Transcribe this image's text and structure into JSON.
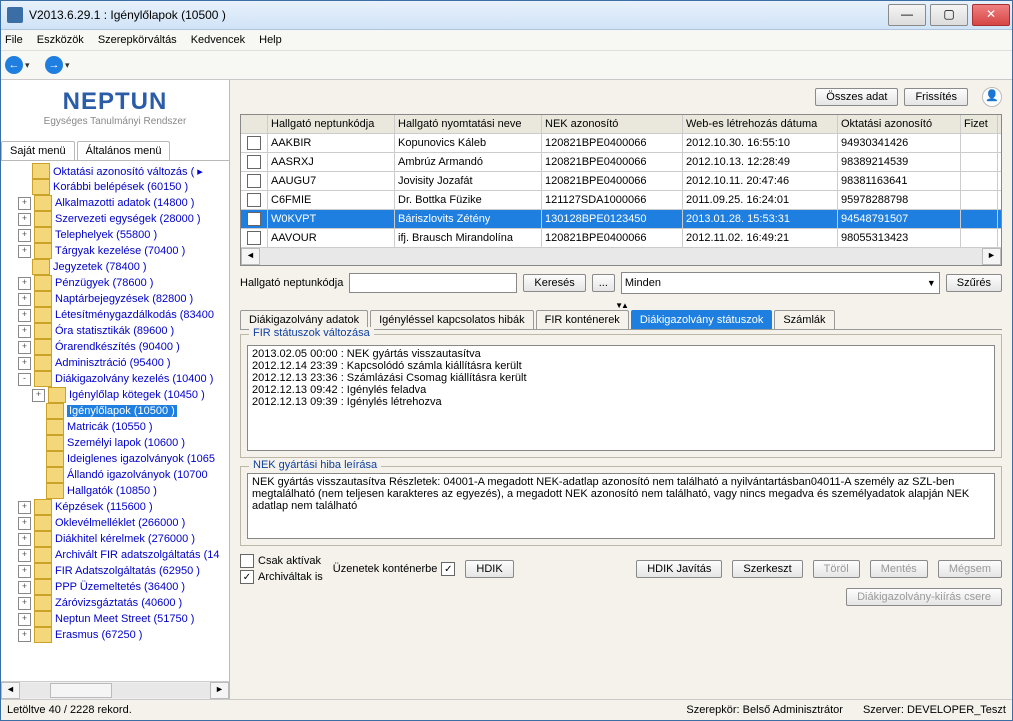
{
  "window_title": "V2013.6.29.1 : Igénylőlapok (10500  )",
  "menu": {
    "file": "File",
    "tools": "Eszközök",
    "role": "Szerepkörváltás",
    "fav": "Kedvencek",
    "help": "Help"
  },
  "logo": {
    "name": "NEPTUN",
    "sub": "Egységes Tanulmányi Rendszer"
  },
  "side_tabs": {
    "own": "Saját menü",
    "general": "Általános menü"
  },
  "tree": [
    {
      "lvl": 1,
      "exp": "",
      "label": "Oktatási azonosító változás (  ▸"
    },
    {
      "lvl": 1,
      "exp": "",
      "label": "Korábbi belépések (60150  )"
    },
    {
      "lvl": 1,
      "exp": "+",
      "label": "Alkalmazotti adatok (14800  )"
    },
    {
      "lvl": 1,
      "exp": "+",
      "label": "Szervezeti egységek (28000  )"
    },
    {
      "lvl": 1,
      "exp": "+",
      "label": "Telephelyek (55800  )"
    },
    {
      "lvl": 1,
      "exp": "+",
      "label": "Tárgyak kezelése (70400  )"
    },
    {
      "lvl": 1,
      "exp": "",
      "label": "Jegyzetek (78400  )"
    },
    {
      "lvl": 1,
      "exp": "+",
      "label": "Pénzügyek (78600  )"
    },
    {
      "lvl": 1,
      "exp": "+",
      "label": "Naptárbejegyzések (82800  )"
    },
    {
      "lvl": 1,
      "exp": "+",
      "label": "Létesítménygazdálkodás (83400"
    },
    {
      "lvl": 1,
      "exp": "+",
      "label": "Óra statisztikák (89600  )"
    },
    {
      "lvl": 1,
      "exp": "+",
      "label": "Órarendkészítés (90400  )"
    },
    {
      "lvl": 1,
      "exp": "+",
      "label": "Adminisztráció (95400  )"
    },
    {
      "lvl": 1,
      "exp": "-",
      "label": "Diákigazolvány kezelés (10400  )"
    },
    {
      "lvl": 2,
      "exp": "+",
      "label": "Igénylőlap kötegek (10450  )"
    },
    {
      "lvl": 2,
      "exp": "",
      "label": "Igénylőlapok (10500  )",
      "sel": true
    },
    {
      "lvl": 2,
      "exp": "",
      "label": "Matricák (10550  )"
    },
    {
      "lvl": 2,
      "exp": "",
      "label": "Személyi lapok (10600  )"
    },
    {
      "lvl": 2,
      "exp": "",
      "label": "Ideiglenes igazolványok (1065"
    },
    {
      "lvl": 2,
      "exp": "",
      "label": "Állandó igazolványok (10700"
    },
    {
      "lvl": 2,
      "exp": "",
      "label": "Hallgatók (10850  )"
    },
    {
      "lvl": 1,
      "exp": "+",
      "label": "Képzések (115600  )"
    },
    {
      "lvl": 1,
      "exp": "+",
      "label": "Oklevélmelléklet (266000  )"
    },
    {
      "lvl": 1,
      "exp": "+",
      "label": "Diákhitel kérelmek (276000  )"
    },
    {
      "lvl": 1,
      "exp": "+",
      "label": "Archivált FIR adatszolgáltatás (14"
    },
    {
      "lvl": 1,
      "exp": "+",
      "label": "FIR Adatszolgáltatás (62950  )"
    },
    {
      "lvl": 1,
      "exp": "+",
      "label": "PPP Üzemeltetés (36400  )"
    },
    {
      "lvl": 1,
      "exp": "+",
      "label": "Záróvizsgáztatás (40600  )"
    },
    {
      "lvl": 1,
      "exp": "+",
      "label": "Neptun Meet Street (51750  )"
    },
    {
      "lvl": 1,
      "exp": "+",
      "label": "Erasmus (67250  )"
    }
  ],
  "buttons": {
    "all": "Összes adat",
    "refresh": "Frissítés",
    "search": "Keresés",
    "dots": "...",
    "filter": "Szűrés",
    "hdik": "HDIK",
    "hdikfix": "HDIK Javítás",
    "edit": "Szerkeszt",
    "del": "Töröl",
    "save": "Mentés",
    "cancel": "Mégsem",
    "replace": "Diákigazolvány-kiírás csere"
  },
  "grid": {
    "headers": {
      "a": "Hallgató neptunkódja",
      "b": "Hallgató nyomtatási neve",
      "c": "NEK azonosító",
      "d": "Web-es létrehozás dátuma",
      "e": "Oktatási azonosító",
      "f": "Fizet"
    },
    "rows": [
      {
        "a": "AAKBIR",
        "b": "Kopunovics Káleb",
        "c": "120821BPE0400066",
        "d": "2012.10.30. 16:55:10",
        "e": "94930341426"
      },
      {
        "a": "AASRXJ",
        "b": "Ambrúz Armandó",
        "c": "120821BPE0400066",
        "d": "2012.10.13. 12:28:49",
        "e": "98389214539"
      },
      {
        "a": "AAUGU7",
        "b": "Jovisity Jozafát",
        "c": "120821BPE0400066",
        "d": "2012.10.11. 20:47:46",
        "e": "98381163641"
      },
      {
        "a": "C6FMIE",
        "b": "Dr. Bottka Füzike",
        "c": "121127SDA1000066",
        "d": "2011.09.25. 16:24:01",
        "e": "95978288798"
      },
      {
        "a": "W0KVPT",
        "b": "Báriszlovits Zétény",
        "c": "130128BPE0123450",
        "d": "2013.01.28. 15:53:31",
        "e": "94548791507",
        "sel": true
      },
      {
        "a": "AAVOUR",
        "b": "ifj. Brausch Mirandolína",
        "c": "120821BPE0400066",
        "d": "2012.11.02. 16:49:21",
        "e": "98055313423"
      }
    ]
  },
  "search": {
    "label": "Hallgató neptunkódja",
    "value": "",
    "dropdown": "Minden"
  },
  "detail_tabs": {
    "t1": "Diákigazolvány adatok",
    "t2": "Igényléssel kapcsolatos hibák",
    "t3": "FIR konténerek",
    "t4": "Diákigazolvány státuszok",
    "t5": "Számlák"
  },
  "group1": {
    "caption": "FIR státuszok változása",
    "log": [
      "2013.02.05 00:00 : NEK gyártás visszautasítva",
      "2012.12.14 23:39 : Kapcsolódó számla kiállításra került",
      "2012.12.13 23:36 : Számlázási Csomag kiállításra került",
      "2012.12.13 09:42 : Igénylés feladva",
      "2012.12.13 09:39 : Igénylés létrehozva"
    ]
  },
  "group2": {
    "caption": "NEK gyártási hiba leírása",
    "text": "NEK gyártás visszautasítva Részletek: 04001-A megadott NEK-adatlap azonosító nem található a nyilvántartásban04011-A személy az SZL-ben megtalálható (nem teljesen karakteres az egyezés), a megadott NEK azonosító nem található, vagy nincs megadva és személyadatok alapján NEK adatlap nem található"
  },
  "checks": {
    "only": "Csak aktívak",
    "arch": "Archiváltak is",
    "cont": "Üzenetek konténerbe"
  },
  "status": {
    "left": "Letöltve 40 / 2228 rekord.",
    "role": "Szerepkör: Belső Adminisztrátor",
    "server": "Szerver: DEVELOPER_Teszt"
  }
}
